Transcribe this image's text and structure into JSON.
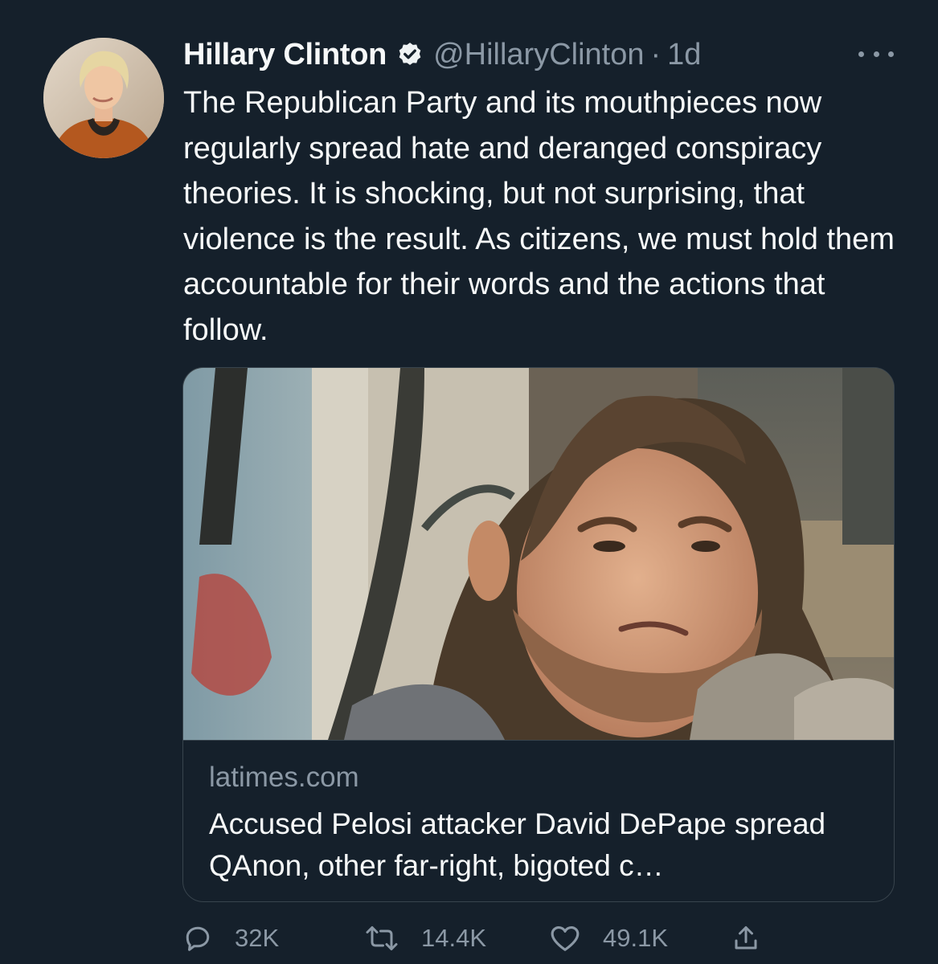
{
  "tweet": {
    "author_name": "Hillary Clinton",
    "handle": "@HillaryClinton",
    "separator": "·",
    "timestamp": "1d",
    "verified": true,
    "text": "The Republican Party and its mouthpieces now regularly spread hate and deranged conspiracy theories. It is shocking, but not surprising, that violence is the result. As citizens, we must hold them accountable for their words and the actions that follow."
  },
  "card": {
    "domain": "latimes.com",
    "title": "Accused Pelosi attacker David DePape spread QAnon, other far-right, bigoted c…"
  },
  "actions": {
    "replies": "32K",
    "retweets": "14.4K",
    "likes": "49.1K"
  },
  "icons": {
    "verified": "verified-badge-icon",
    "more": "more-options-icon",
    "reply": "reply-icon",
    "retweet": "retweet-icon",
    "like": "heart-icon",
    "share": "share-icon"
  },
  "colors": {
    "background": "#15202b",
    "primary_text": "#f7f9f9",
    "secondary_text": "#8b98a5",
    "border": "#38444d"
  }
}
